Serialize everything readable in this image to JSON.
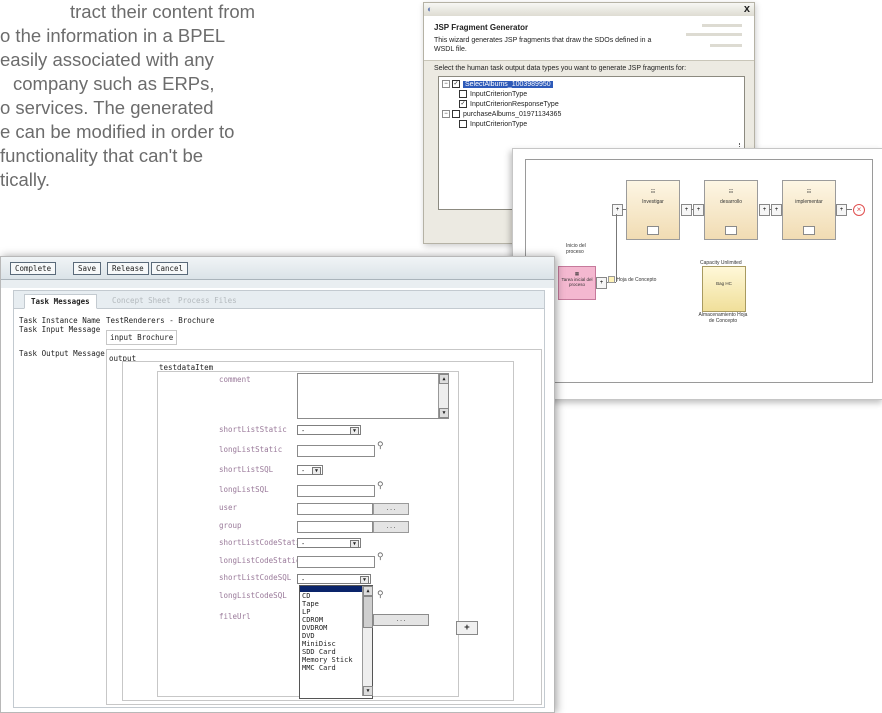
{
  "intro": {
    "lines": [
      "tract their content from",
      "o the information in a BPEL",
      "easily associated with any",
      "company such as ERPs,",
      "o services. The generated",
      "e can be modified in order to",
      "functionality that can't be",
      "tically."
    ]
  },
  "wizard": {
    "title": "JSP Fragment Generator",
    "description": "This wizard generates JSP fragments that draw the SDOs defined in a WSDL file.",
    "prompt": "Select the human task output data types you want to generate JSP fragments for:",
    "close_label": "x",
    "tree": [
      {
        "label": "SelectAlbums_1003989950",
        "checked": true,
        "selected": true
      },
      {
        "label": "InputCriterionType",
        "checked": false
      },
      {
        "label": "InputCriterionResponseType",
        "checked": true
      },
      {
        "label": "purchaseAlbums_01971134365",
        "checked": false
      },
      {
        "label": "InputCriterionType",
        "checked": false
      }
    ]
  },
  "bpel": {
    "nodes": [
      "Investigar",
      "desarrollo",
      "implementar"
    ],
    "start_label": "Inicio del proceso",
    "pink_label": "Tarea inicial del proceso",
    "doc_label": "Hoja de Concepto",
    "data_label": "Capacity Unlimited",
    "store_label": "Bag HC",
    "store_caption": "Almacenamiento Hoja de Concepto"
  },
  "form": {
    "toolbar": {
      "complete": "Complete",
      "save": "Save",
      "release": "Release",
      "cancel": "Cancel"
    },
    "tabs": {
      "messages": "Task Messages",
      "concept": "Concept Sheet",
      "process": "Process Files"
    },
    "task_instance_name_label": "Task Instance Name",
    "task_instance_name_value": "TestRenderers - Brochure",
    "task_input_message_label": "Task Input Message",
    "task_input_message_value": "input  Brochure",
    "task_output_message_label": "Task Output Message",
    "output_label": "output",
    "item_label": "testdataItem",
    "add_button": "+",
    "fields": {
      "comment": "comment",
      "shortListStatic": "shortListStatic",
      "longListStatic": "longListStatic",
      "shortListSQL": "shortListSQL",
      "longListSQL": "longListSQL",
      "user": "user",
      "group": "group",
      "shortListCodeStatic": "shortListCodeStatic",
      "longListCodeStatic": "longListCodeStatic",
      "shortListCodeSQL": "shortListCodeSQL",
      "longListCodeSQL": "longListCodeSQL",
      "fileUrl": "fileUrl"
    },
    "select_default": "-",
    "lookup_button": "...",
    "list_options": [
      "CD",
      "Tape",
      "LP",
      "CDROM",
      "DVDROM",
      "DVD",
      "MiniDisc",
      "SDD Card",
      "Memory Stick",
      "MMC Card"
    ]
  }
}
